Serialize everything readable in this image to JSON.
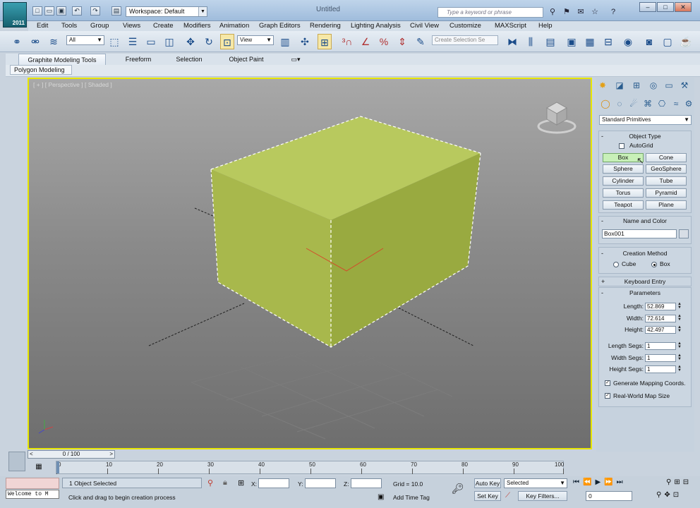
{
  "titlebar": {
    "app_badge": "2011",
    "workspace": "Workspace: Default",
    "title": "Untitled",
    "search_placeholder": "Type a keyword or phrase"
  },
  "menu": [
    "Edit",
    "Tools",
    "Group",
    "Views",
    "Create",
    "Modifiers",
    "Animation",
    "Graph Editors",
    "Rendering",
    "Lighting Analysis",
    "Civil View",
    "Customize",
    "MAXScript",
    "Help"
  ],
  "toolbar": {
    "selection_filter": "All",
    "ref_coord": "View",
    "selection_set_placeholder": "Create Selection Se"
  },
  "ribbon": {
    "tabs": [
      "Graphite Modeling Tools",
      "Freeform",
      "Selection",
      "Object Paint"
    ],
    "panel": "Polygon Modeling"
  },
  "viewport": {
    "label": "[ + ] [ Perspective ] [ Shaded ]",
    "object_color": "#b5c55a",
    "border_color": "#e7e600"
  },
  "command_panel": {
    "dropdown": "Standard Primitives",
    "object_type": {
      "title": "Object Type",
      "autogrid": "AutoGrid",
      "buttons": [
        "Box",
        "Cone",
        "Sphere",
        "GeoSphere",
        "Cylinder",
        "Tube",
        "Torus",
        "Pyramid",
        "Teapot",
        "Plane"
      ],
      "active": "Box"
    },
    "name_and_color": {
      "title": "Name and Color",
      "name": "Box001"
    },
    "creation_method": {
      "title": "Creation Method",
      "options": [
        "Cube",
        "Box"
      ],
      "selected": "Box"
    },
    "keyboard_entry": "Keyboard Entry",
    "parameters": {
      "title": "Parameters",
      "length_label": "Length:",
      "length": "52.869",
      "width_label": "Width:",
      "width": "72.614",
      "height_label": "Height:",
      "height": "42.497",
      "length_segs_label": "Length Segs:",
      "length_segs": "1",
      "width_segs_label": "Width Segs:",
      "width_segs": "1",
      "height_segs_label": "Height Segs:",
      "height_segs": "1",
      "gen_mapping": "Generate Mapping Coords.",
      "real_world": "Real-World Map Size"
    }
  },
  "timeline": {
    "slider": "0 / 100",
    "ticks": [
      "0",
      "10",
      "20",
      "30",
      "40",
      "50",
      "60",
      "70",
      "80",
      "90",
      "100"
    ]
  },
  "status": {
    "maxscript": "Welcome to M",
    "selected": "1 Object Selected",
    "prompt": "Click and drag to begin creation process",
    "x_label": "X:",
    "y_label": "Y:",
    "z_label": "Z:",
    "grid": "Grid = 10.0",
    "add_time_tag": "Add Time Tag",
    "auto_key": "Auto Key",
    "set_key": "Set Key",
    "key_mode": "Selected",
    "key_filters": "Key Filters...",
    "frame": "0"
  }
}
